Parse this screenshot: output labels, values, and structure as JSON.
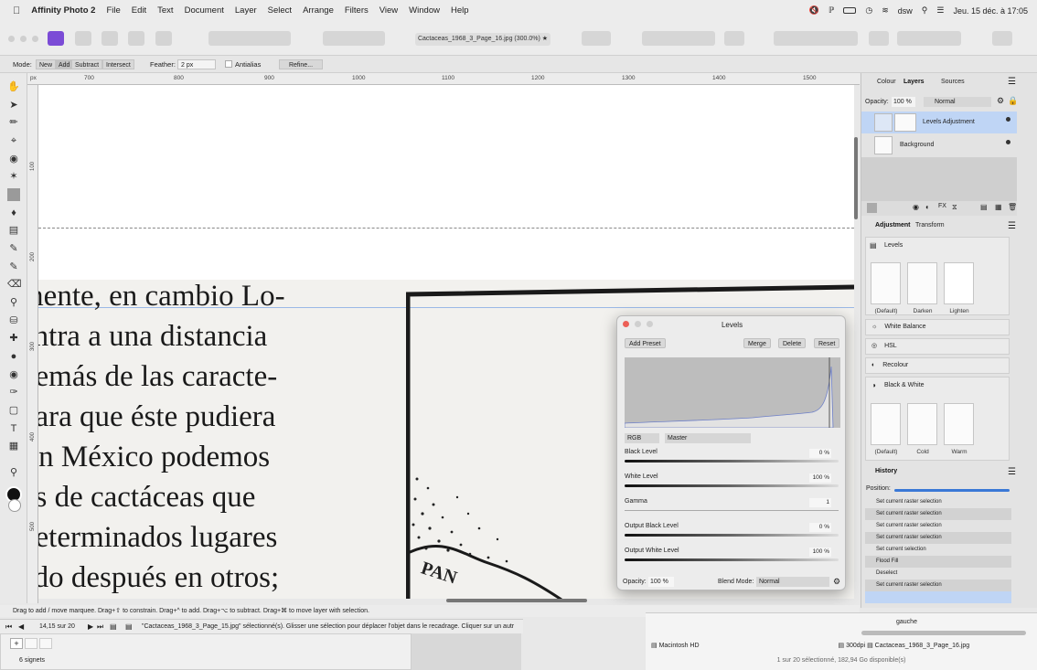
{
  "menubar": {
    "app": "Affinity Photo 2",
    "items": [
      "File",
      "Edit",
      "Text",
      "Document",
      "Layer",
      "Select",
      "Arrange",
      "Filters",
      "View",
      "Window",
      "Help"
    ],
    "user": "dsw",
    "datetime": "Jeu. 15 déc. à 17:05"
  },
  "document": {
    "title": "Cactaceas_1968_3_Page_16.jpg (300.0%) ★"
  },
  "context": {
    "mode_label": "Mode:",
    "modes": [
      "New",
      "Add",
      "Subtract",
      "Intersect"
    ],
    "feather_label": "Feather:",
    "feather_value": "2 px",
    "antialias": "Antialias",
    "refine": "Refine..."
  },
  "ruler": {
    "unit": "px",
    "h_ticks": [
      "700",
      "800",
      "900",
      "1000",
      "1100",
      "1200",
      "1300",
      "1400",
      "1500"
    ],
    "v_ticks": [
      "100",
      "200",
      "300",
      "400",
      "500"
    ]
  },
  "scan_text": [
    "mente, en cambio Lo-",
    "entra a una distancia",
    "demás de las caracte-",
    "para que éste pudiera",
    " En México podemos",
    "os de cactáceas que",
    "determinados lugares",
    "ado después en otros;"
  ],
  "scan_map_label": "PAN",
  "layers_panel": {
    "tabs": [
      "Colour",
      "Layers",
      "Sources"
    ],
    "opacity_label": "Opacity:",
    "opacity_value": "100 %",
    "blend": "Normal",
    "layers": [
      "Levels Adjustment",
      "Background"
    ]
  },
  "adjustment_panel": {
    "tabs": [
      "Adjustment",
      "Transform"
    ],
    "items": [
      "Levels",
      "White Balance",
      "HSL",
      "Recolour",
      "Black & White"
    ],
    "levels_presets": [
      "(Default)",
      "Darken",
      "Lighten"
    ],
    "bw_presets": [
      "(Default)",
      "Cold",
      "Warm"
    ]
  },
  "history_panel": {
    "title": "History",
    "position_label": "Position:",
    "entries": [
      "Set current raster selection",
      "Set current raster selection",
      "Set current raster selection",
      "Set current raster selection",
      "Set current selection",
      "Flood Fill",
      "Deselect",
      "Set current raster selection"
    ]
  },
  "levels_dialog": {
    "title": "Levels",
    "buttons": [
      "Add Preset",
      "Merge",
      "Delete",
      "Reset"
    ],
    "channel": "RGB",
    "channel_mode": "Master",
    "rows": [
      {
        "label": "Black Level",
        "value": "0 %"
      },
      {
        "label": "White Level",
        "value": "100 %"
      },
      {
        "label": "Gamma",
        "value": "1"
      },
      {
        "label": "Output Black Level",
        "value": "0 %"
      },
      {
        "label": "Output White Level",
        "value": "100 %"
      }
    ],
    "opacity_label": "Opacity:",
    "opacity_value": "100 %",
    "blend_label": "Blend Mode:",
    "blend_value": "Normal"
  },
  "status": {
    "hint": "Drag to add / move marquee. Drag+⇧ to constrain. Drag+^ to add. Drag+⌥ to subtract. Drag+⌘ to move layer with selection.",
    "page": "14,15 sur 20",
    "selection_msg": "\"Cactaceas_1968_3_Page_15.jpg\" sélectionné(s). Glisser une sélection pour déplacer l'objet dans le recadrage. Cliquer sur un autr",
    "signets": "6 signets"
  },
  "finder": {
    "col_label": "gauche",
    "path": [
      "Macintosh HD",
      "300dpi",
      "Cactaceas_1968_3_Page_16.jpg"
    ],
    "footer": "1 sur 20 sélectionné, 182,94 Go disponible(s)"
  },
  "colors": {
    "accent": "#3a78d6",
    "selected_layer": "#bfd5f5"
  }
}
